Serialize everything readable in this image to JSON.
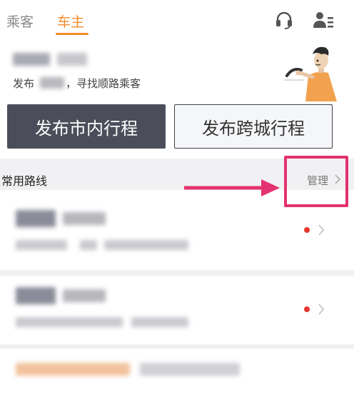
{
  "tabs": {
    "passenger": "乘客",
    "driver": "车主"
  },
  "user_card": {
    "subtitle_prefix": "发布",
    "subtitle_suffix": "，寻找顺路乘客"
  },
  "buttons": {
    "publish_city": "发布市内行程",
    "publish_intercity": "发布跨城行程"
  },
  "routes": {
    "title": "常用路线",
    "manage_label": "管理"
  },
  "colors": {
    "accent_orange": "#f08c2c",
    "primary_button": "#4b4e5a",
    "annotation_pink": "#e3326f",
    "unread_dot": "#e6372e"
  },
  "icons": {
    "headset": "headset-icon",
    "profile": "profile-menu-icon",
    "chevron": "chevron-right-icon"
  }
}
